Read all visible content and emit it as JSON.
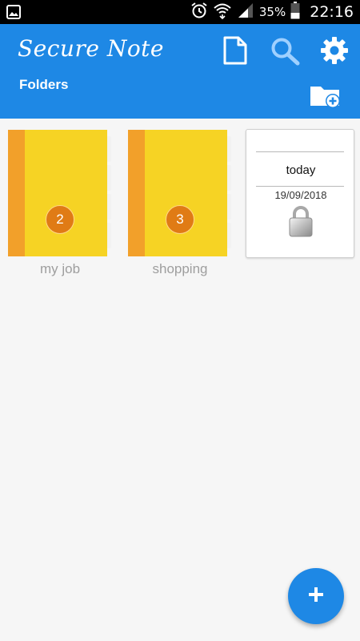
{
  "status_bar": {
    "battery_percent": "35%",
    "time": "22:16",
    "icons": [
      "image-notification-icon",
      "alarm-icon",
      "wifi-icon",
      "signal-icon",
      "battery-icon"
    ]
  },
  "app_bar": {
    "title": "Secure Note",
    "subtitle": "Folders",
    "actions": [
      "new-note-icon",
      "search-icon",
      "settings-icon",
      "add-folder-icon"
    ]
  },
  "folders": [
    {
      "label": "my job",
      "count": "2"
    },
    {
      "label": "shopping",
      "count": "3"
    }
  ],
  "note": {
    "title": "today",
    "date": "19/09/2018",
    "icon": "lock-icon"
  },
  "fab": {
    "icon": "plus-icon",
    "label": "+"
  },
  "colors": {
    "primary": "#1e88e5",
    "folder_yellow": "#f5d022",
    "folder_spine": "#f2a02a",
    "badge": "#e07b15"
  }
}
